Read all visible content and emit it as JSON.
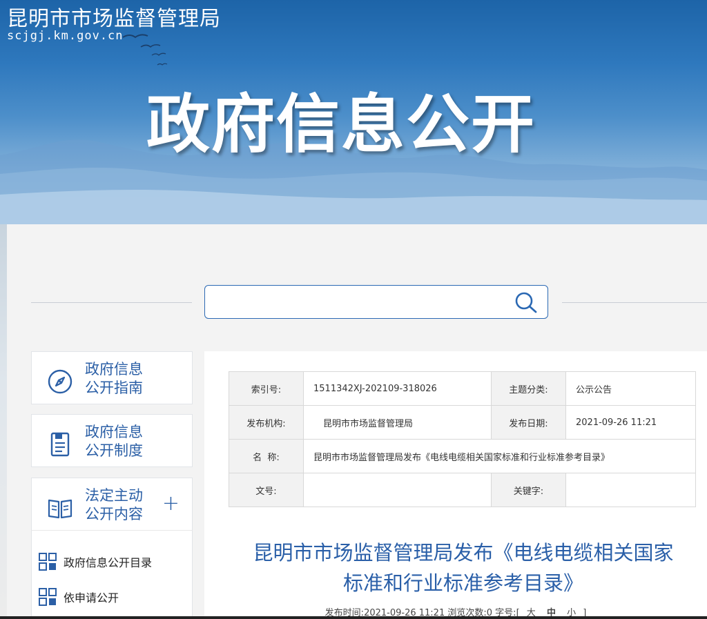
{
  "header": {
    "site_name": "昆明市市场监督管理局",
    "site_url": "scjgj.km.gov.cn",
    "banner_title": "政府信息公开"
  },
  "search": {
    "placeholder": "",
    "value": ""
  },
  "sidebar": {
    "items": [
      {
        "line1": "政府信息",
        "line2": "公开指南",
        "icon": "compass-icon"
      },
      {
        "line1": "政府信息",
        "line2": "公开制度",
        "icon": "document-icon"
      },
      {
        "line1": "法定主动",
        "line2": "公开内容",
        "icon": "book-icon",
        "expand": "+"
      }
    ],
    "sub_items": [
      {
        "label": "政府信息公开目录",
        "icon": "grid-icon"
      },
      {
        "label": "依申请公开",
        "icon": "grid-icon"
      }
    ]
  },
  "meta_table": {
    "index_label": "索引号:",
    "index_value": "1511342XJ-202109-318026",
    "topic_label": "主题分类:",
    "topic_value": "公示公告",
    "org_label": "发布机构:",
    "org_value": "昆明市市场监督管理局",
    "date_label": "发布日期:",
    "date_value": "2021-09-26 11:21",
    "name_label": "名  称:",
    "name_value": "昆明市市场监督管理局发布《电线电缆相关国家标准和行业标准参考目录》",
    "docno_label": "文号:",
    "docno_value": "",
    "keyword_label": "关键字:",
    "keyword_value": ""
  },
  "article": {
    "title_line1": "昆明市市场监督管理局发布《电线电缆相关国家",
    "title_line2": "标准和行业标准参考目录》",
    "pub_time_label": "发布时间:",
    "pub_time": "2021-09-26 11:21",
    "views_label": "浏览次数:",
    "views": "0",
    "font_size_label": "字号:",
    "bracket_open": "[",
    "font_large": "大",
    "font_medium": "中",
    "font_small": "小",
    "bracket_close": "]"
  },
  "colors": {
    "accent": "#2a5fa8",
    "banner_top": "#1d64a8",
    "search_border": "#2a68b3"
  }
}
